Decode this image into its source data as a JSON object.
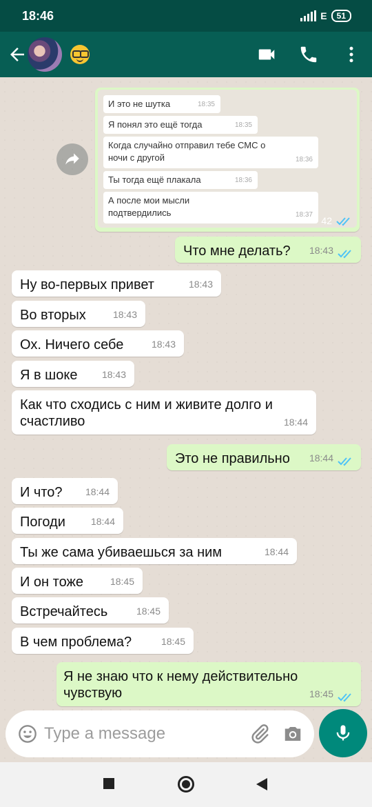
{
  "status": {
    "time": "18:46",
    "network": "E",
    "battery": "51"
  },
  "header": {
    "avatar": "contact-avatar",
    "status_emoji": "nerd-face-emoji"
  },
  "forwarded": {
    "time_overlay": "42",
    "messages": [
      {
        "text": "И это не шутка",
        "time": "18:35"
      },
      {
        "text": "Я понял это ещё тогда",
        "time": "18:35"
      },
      {
        "text": "Когда случайно отправил тебе СМС о ночи с другой",
        "time": "18:36"
      },
      {
        "text": "Ты тогда ещё плакала",
        "time": "18:36"
      },
      {
        "text": "А после мои мысли подтвердились",
        "time": "18:37"
      }
    ]
  },
  "messages": [
    {
      "dir": "out",
      "text": "Что мне делать?",
      "time": "18:43"
    },
    {
      "dir": "in",
      "text": "Ну во-первых привет",
      "time": "18:43"
    },
    {
      "dir": "in",
      "text": "Во вторых",
      "time": "18:43"
    },
    {
      "dir": "in",
      "text": "Ох. Ничего себе",
      "time": "18:43"
    },
    {
      "dir": "in",
      "text": "Я в шоке",
      "time": "18:43"
    },
    {
      "dir": "in",
      "text": "Как что сходись с ним и живите долго и счастливо",
      "time": "18:44"
    },
    {
      "dir": "out",
      "text": "Это не правильно",
      "time": "18:44"
    },
    {
      "dir": "in",
      "text": "И что?",
      "time": "18:44"
    },
    {
      "dir": "in",
      "text": "Погоди",
      "time": "18:44"
    },
    {
      "dir": "in",
      "text": "Ты же сама убиваешься за ним",
      "time": "18:44"
    },
    {
      "dir": "in",
      "text": "И он тоже",
      "time": "18:45"
    },
    {
      "dir": "in",
      "text": "Встречайтесь",
      "time": "18:45"
    },
    {
      "dir": "in",
      "text": "В чем проблема?",
      "time": "18:45"
    },
    {
      "dir": "out",
      "text": "Я не знаю что к нему действительно чувствую",
      "time": "18:45"
    }
  ],
  "input": {
    "placeholder": "Type a message"
  },
  "colors": {
    "header": "#075e54",
    "outgoing": "#dcf8c6",
    "incoming": "#ffffff",
    "accent": "#00897b",
    "ticks": "#4fc3f7"
  }
}
